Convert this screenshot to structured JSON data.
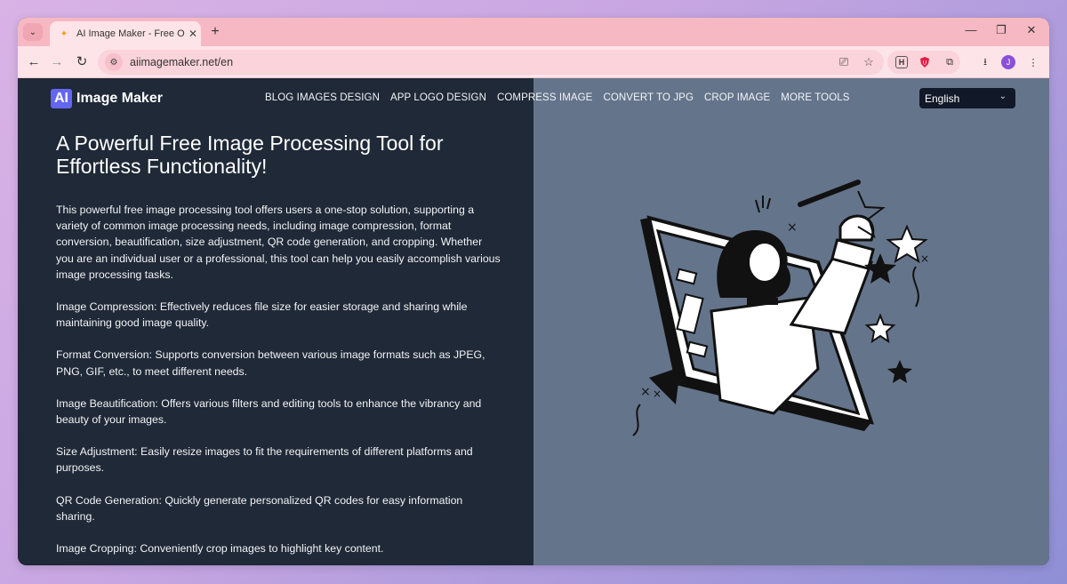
{
  "browser": {
    "tab_title": "AI Image Maker - Free Online D",
    "url": "aiimagemaker.net/en",
    "avatar_letter": "J",
    "ext_h_label": "H"
  },
  "site": {
    "logo_badge": "AI",
    "logo_text": "Image Maker",
    "nav": [
      "BLOG IMAGES DESIGN",
      "APP LOGO DESIGN",
      "COMPRESS IMAGE",
      "CONVERT TO JPG",
      "CROP IMAGE",
      "MORE TOOLS"
    ],
    "language": "English"
  },
  "main": {
    "heading": "A Powerful Free Image Processing Tool for Effortless Functionality!",
    "paragraphs": [
      "This powerful free image processing tool offers users a one-stop solution, supporting a variety of common image processing needs, including image compression, format conversion, beautification, size adjustment, QR code generation, and cropping. Whether you are an individual user or a professional, this tool can help you easily accomplish various image processing tasks.",
      "Image Compression: Effectively reduces file size for easier storage and sharing while maintaining good image quality.",
      "Format Conversion: Supports conversion between various image formats such as JPEG, PNG, GIF, etc., to meet different needs.",
      "Image Beautification: Offers various filters and editing tools to enhance the vibrancy and beauty of your images.",
      "Size Adjustment: Easily resize images to fit the requirements of different platforms and purposes.",
      "QR Code Generation: Quickly generate personalized QR codes for easy information sharing.",
      "Image Cropping: Conveniently crop images to highlight key content."
    ]
  },
  "colors": {
    "left_bg": "#1f2937",
    "right_bg": "#64748b",
    "logo_accent": "#6366f1",
    "tabbar": "#f6b8c2"
  }
}
